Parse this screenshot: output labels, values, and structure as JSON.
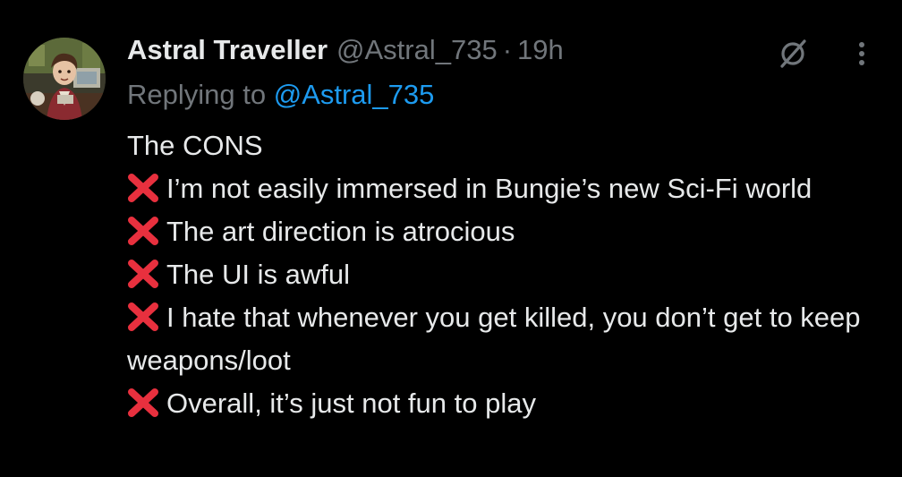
{
  "tweet": {
    "author": {
      "display_name": "Astral Traveller",
      "handle": "@Astral_735",
      "separator": "·",
      "timestamp": "19h",
      "avatar_icon": "profile-avatar"
    },
    "reply_prefix": "Replying to ",
    "reply_to": "@Astral_735",
    "heading": "The CONS",
    "cons": [
      "I’m not easily immersed in Bungie’s new Sci-Fi world",
      "The art direction is atrocious",
      "The UI is awful",
      "I hate that whenever you get killed, you don’t get to keep weapons/loot",
      "Overall, it’s just not fun to play"
    ],
    "cons_marker_icon": "cross-mark-emoji",
    "actions": {
      "grok_icon": "grok-icon",
      "more_icon": "more-options-icon"
    }
  },
  "colors": {
    "background": "#000000",
    "primary_text": "#e7e9ea",
    "secondary_text": "#71767b",
    "link": "#1d9bf0",
    "cross_mark": "#e8303e"
  }
}
